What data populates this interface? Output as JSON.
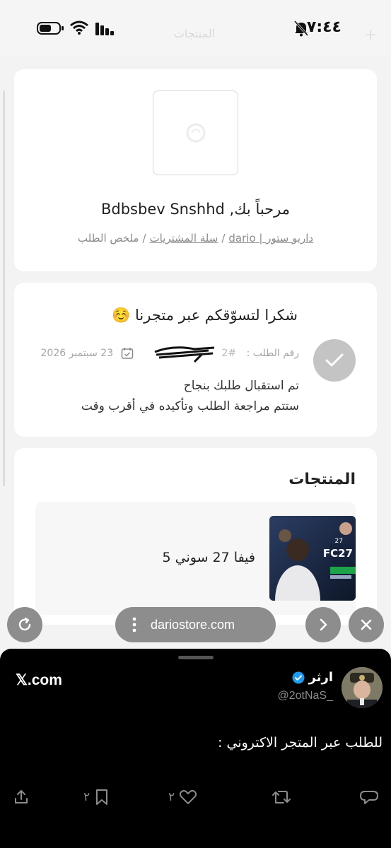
{
  "status_bar": {
    "time": "٧:٤٤"
  },
  "page_header_faded": "المنتجات",
  "welcome": {
    "greeting": "مرحباً بك, Bdbsbev Snshhd",
    "breadcrumb": {
      "home": "داريو ستور | dario",
      "cart": "سلة المشتريات",
      "current": "ملخص الطلب",
      "separator": "/"
    }
  },
  "order": {
    "thanks": "شكرا لتسوّقكم عبر متجرنا ☺️",
    "number_label": "رقم الطلب :",
    "number_value": "#2",
    "date": "23 سبتمبر 2026",
    "status_line1": "تم استقبال طلبك بنجاح",
    "status_line2": "ستتم مراجعة الطلب وتأكيده في أقرب وقت"
  },
  "products": {
    "title": "المنتجات",
    "items": [
      {
        "name": "فيفا 27 سوني 5",
        "image_icon": "fifa-27-cover"
      }
    ]
  },
  "browser": {
    "url": "dariostore.com"
  },
  "share_sheet": {
    "source": "𝕏.com",
    "author_name": "ارثر",
    "author_handle": "@2otNaS_",
    "text": "للطلب عبر المتجر الاكتروني :",
    "bookmark_count": "٢",
    "like_count": "٢"
  },
  "colors": {
    "card_bg": "#ffffff",
    "page_bg": "#f3f3f3",
    "check_circle": "#c4c4c4",
    "browser_controls": "#8d8d8d",
    "sheet_bg": "#000000",
    "verified_blue": "#1d9bf0"
  }
}
